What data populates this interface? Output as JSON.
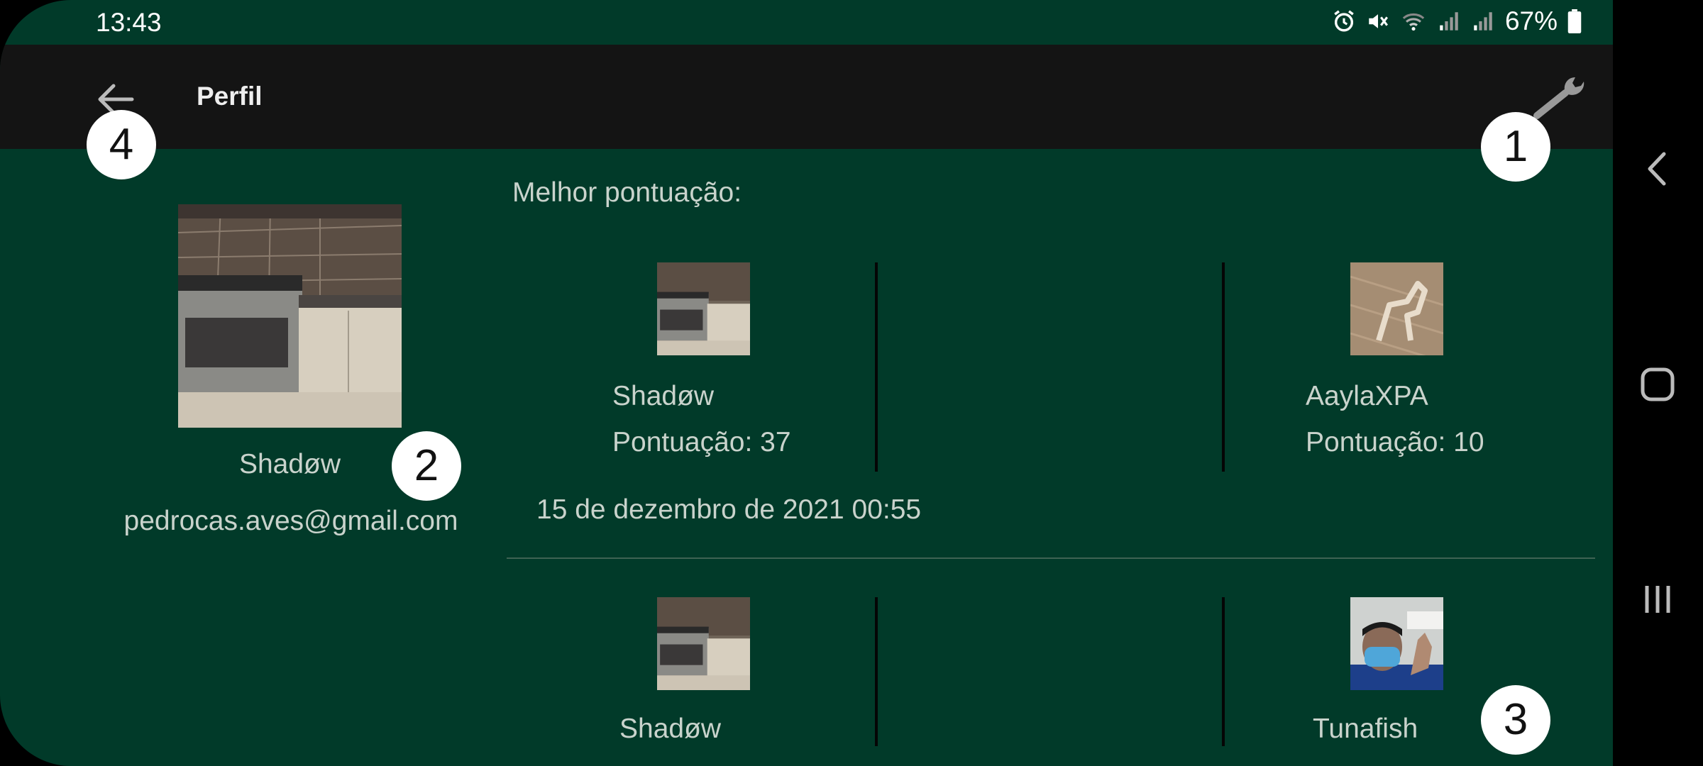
{
  "status_bar": {
    "time": "13:43",
    "battery": "67%",
    "icons": [
      "alarm-icon",
      "mute-icon",
      "wifi-icon",
      "signal-icon",
      "signal-icon",
      "battery-icon"
    ]
  },
  "app_bar": {
    "title": "Perfil",
    "back_icon": "arrow-left-icon",
    "settings_icon": "wrench-icon"
  },
  "badges": [
    "1",
    "2",
    "3",
    "4"
  ],
  "profile": {
    "name": "Shadøw",
    "email": "pedrocas.aves@gmail.com"
  },
  "best_score": {
    "label": "Melhor pontuação:",
    "matches": [
      {
        "player1": {
          "name": "Shadøw",
          "score": "Pontuação: 37"
        },
        "player2": {
          "name": "AaylaXPA",
          "score": "Pontuação: 10"
        },
        "date": "15 de dezembro de 2021 00:55"
      },
      {
        "player1": {
          "name": "Shadøw"
        },
        "player2": {
          "name": "Tunafish"
        }
      }
    ]
  },
  "nav_bar": {
    "icons": [
      "back-triangle-icon",
      "home-icon",
      "recents-icon"
    ]
  },
  "colors": {
    "background": "#013a29",
    "app_bar": "#141414",
    "text": "#c9d3cc",
    "divider": "#3f6253"
  }
}
